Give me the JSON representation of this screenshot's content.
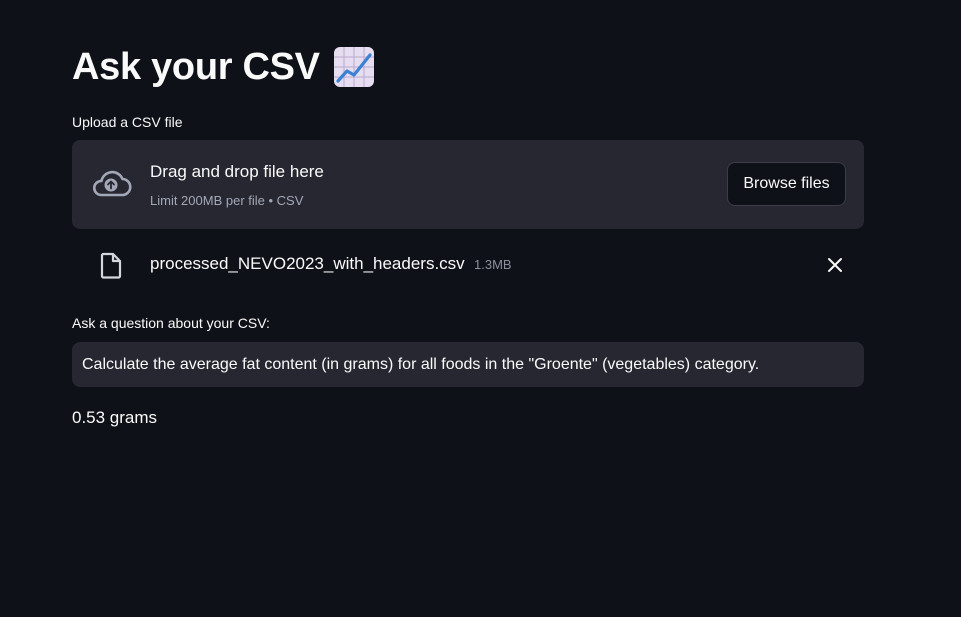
{
  "header": {
    "title": "Ask your CSV",
    "emoji_icon": "chart-increasing-icon"
  },
  "uploader": {
    "label": "Upload a CSV file",
    "drop_title": "Drag and drop file here",
    "drop_limit": "Limit 200MB per file • CSV",
    "browse_label": "Browse files",
    "upload_icon": "cloud-upload-icon"
  },
  "uploaded_file": {
    "name": "processed_NEVO2023_with_headers.csv",
    "size": "1.3MB",
    "file_icon": "file-icon",
    "remove_icon": "close-icon"
  },
  "question": {
    "label": "Ask a question about your CSV:",
    "value": "Calculate the average fat content (in grams) for all foods in the \"Groente\" (vegetables) category."
  },
  "answer": {
    "text": "0.53 grams"
  },
  "colors": {
    "background": "#0e1117",
    "surface": "#262730",
    "text": "#fafafa",
    "muted": "#a3a8b8"
  }
}
